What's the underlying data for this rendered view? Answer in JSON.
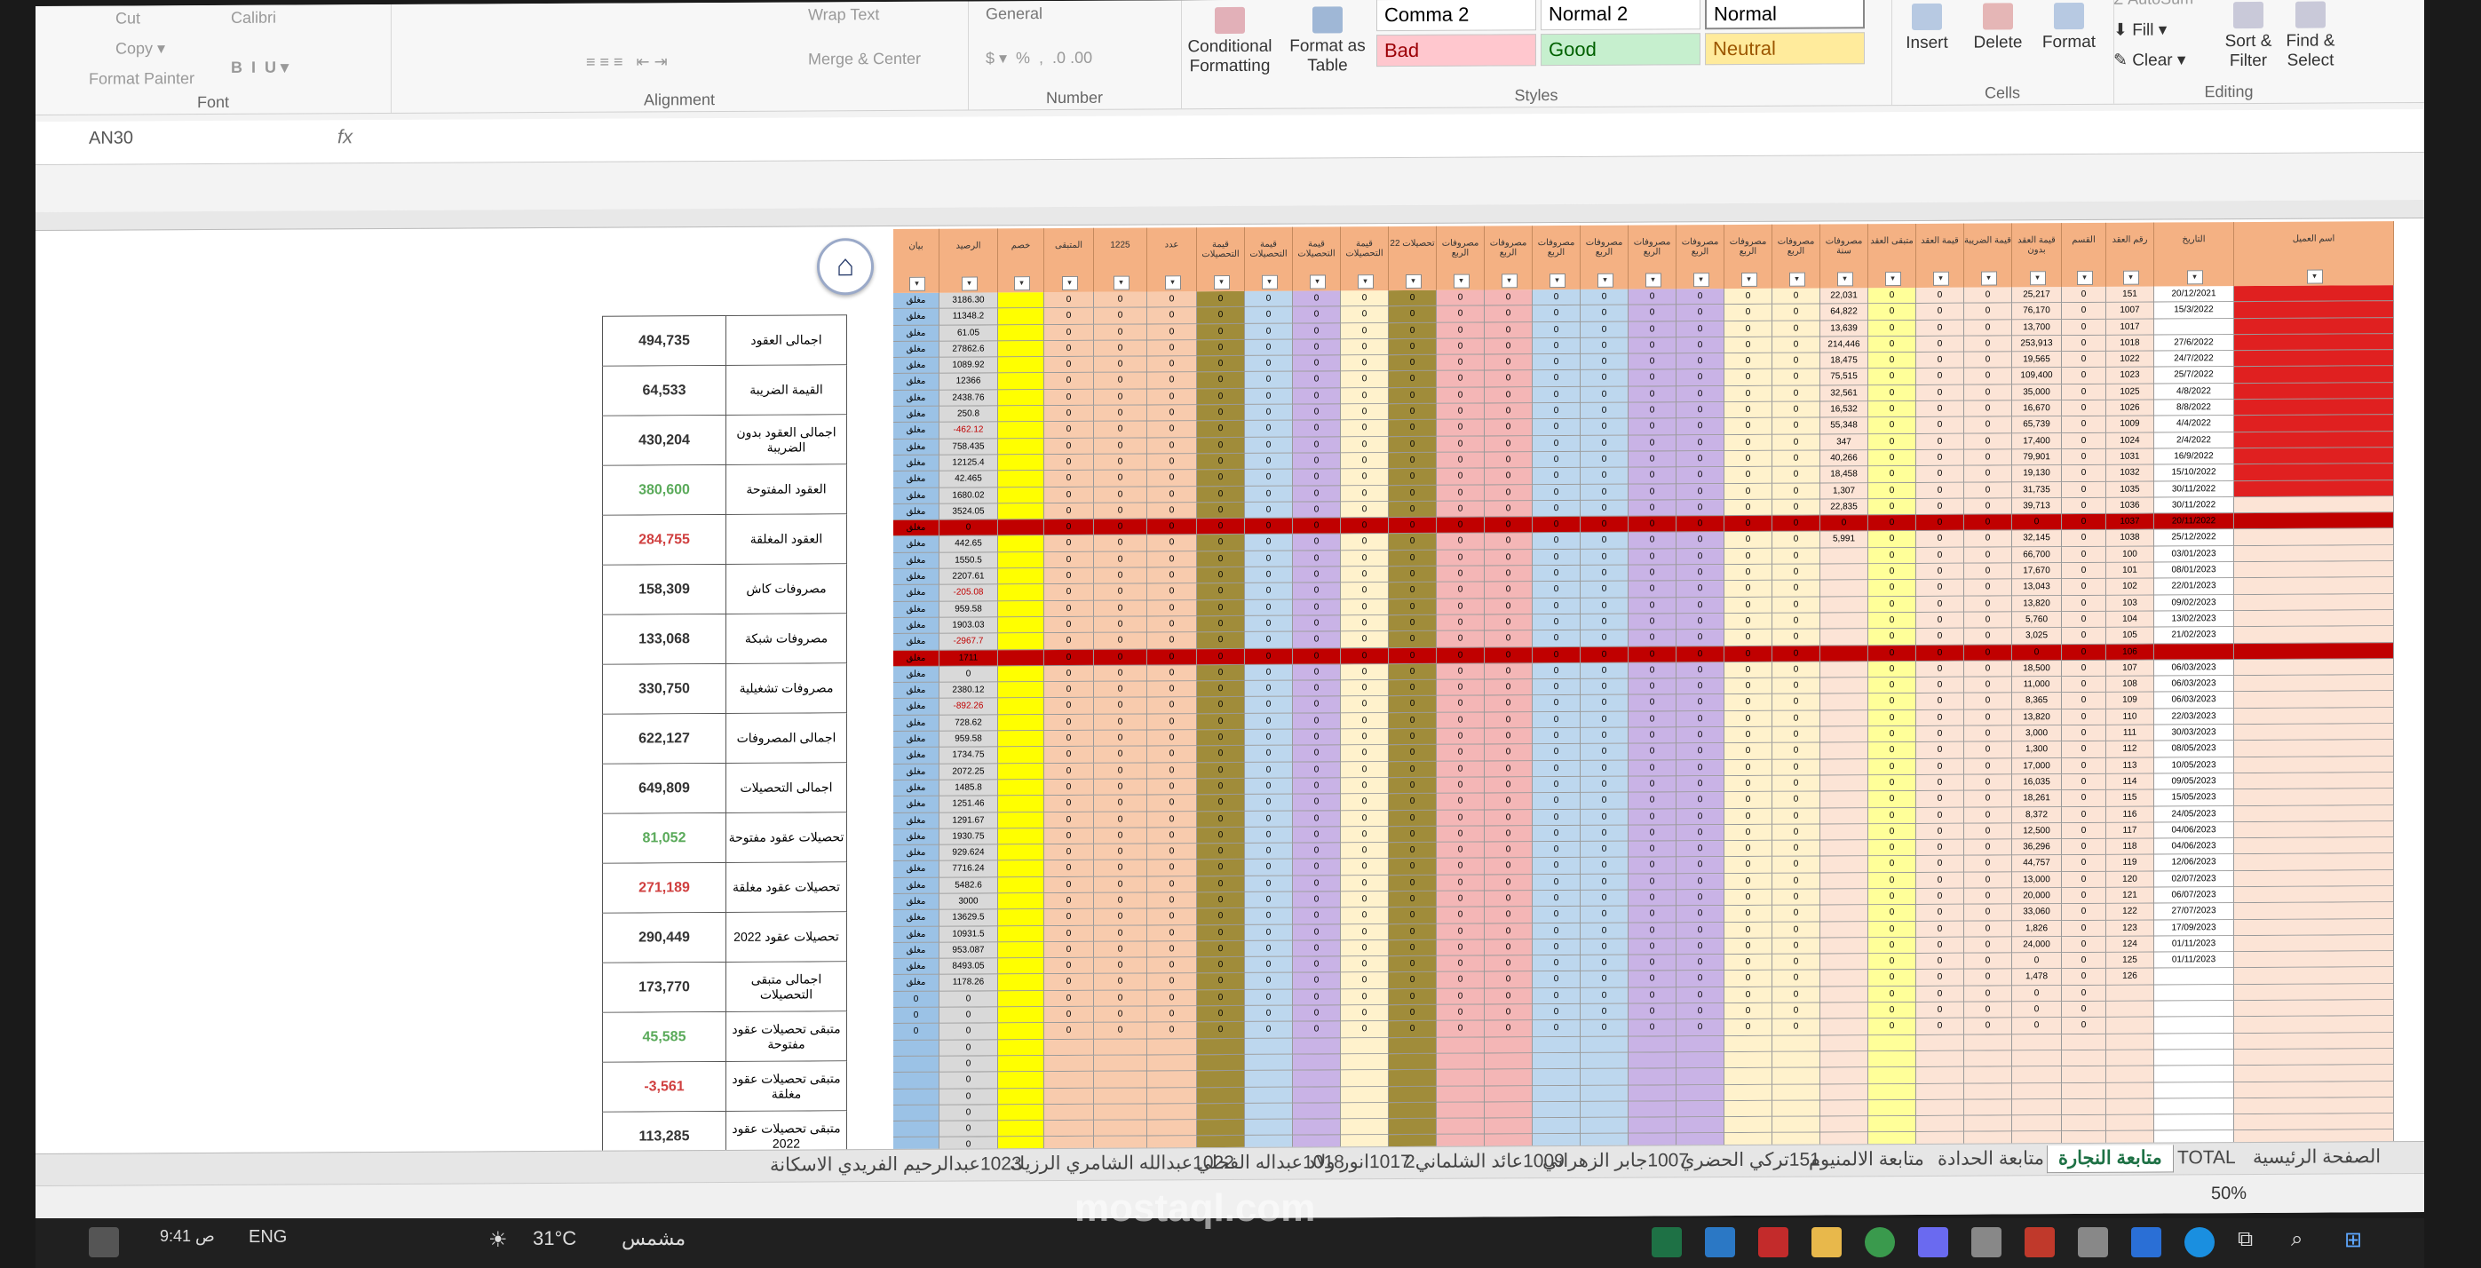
{
  "ribbon": {
    "number_format": "General",
    "wrap_text": "Wrap Text",
    "merge_center": "Merge & Center",
    "format_painter": "Format Painter",
    "conditional_formatting": "Conditional Formatting",
    "format_as_table": "Format as Table",
    "styles": {
      "comma2": "Comma 2",
      "normal2": "Normal 2",
      "normal": "Normal",
      "bad": "Bad",
      "good": "Good",
      "neutral": "Neutral"
    },
    "insert": "Insert",
    "delete": "Delete",
    "format": "Format",
    "autosum": "AutoSum",
    "fill": "Fill",
    "clear": "Clear",
    "sort_filter": "Sort & Filter",
    "find_select": "Find & Select",
    "group_labels": {
      "font": "Font",
      "alignment": "Alignment",
      "number": "Number",
      "styles": "Styles",
      "cells": "Cells",
      "editing": "Editing"
    }
  },
  "formula_bar": {
    "name_box": "AN30",
    "fx": "fx"
  },
  "summary": [
    {
      "value": "494,735",
      "label": "اجمالى العقود",
      "color": "#333"
    },
    {
      "value": "64,533",
      "label": "القيمة الضريبة",
      "color": "#333"
    },
    {
      "value": "430,204",
      "label": "اجمالى العقود بدون الضريبة",
      "color": "#333"
    },
    {
      "value": "380,600",
      "label": "العقود المفتوحة",
      "color": "#5aaa5a"
    },
    {
      "value": "284,755",
      "label": "العقود المغلقة",
      "color": "#d04040"
    },
    {
      "value": "158,309",
      "label": "مصروفات كاش",
      "color": "#333"
    },
    {
      "value": "133,068",
      "label": "مصروفات شبكة",
      "color": "#333"
    },
    {
      "value": "330,750",
      "label": "مصروفات تشغيلية",
      "color": "#333"
    },
    {
      "value": "622,127",
      "label": "اجمالى المصروفات",
      "color": "#333"
    },
    {
      "value": "649,809",
      "label": "اجمالى التحصيلات",
      "color": "#333"
    },
    {
      "value": "81,052",
      "label": "تحصيلات عقود مفتوحة",
      "color": "#5aaa5a"
    },
    {
      "value": "271,189",
      "label": "تحصيلات عقود مغلقة",
      "color": "#d04040"
    },
    {
      "value": "290,449",
      "label": "تحصيلات عقود 2022",
      "color": "#333"
    },
    {
      "value": "173,770",
      "label": "اجمالى متبقى التحصيلات",
      "color": "#333"
    },
    {
      "value": "45,585",
      "label": "متبقى تحصيلات عقود مفتوحة",
      "color": "#5aaa5a"
    },
    {
      "value": "-3,561",
      "label": "متبقى تحصيلات عقود مغلقة",
      "color": "#d04040"
    },
    {
      "value": "113,285",
      "label": "متبقى تحصيلات عقود 2022",
      "color": "#333"
    }
  ],
  "table": {
    "headers": [
      "بيان",
      "الرصيد",
      "خصم",
      "المتبقى",
      "1225",
      "عدد",
      "قيمة التحصيلات",
      "قيمة التحصيلات",
      "قيمة التحصيلات",
      "قيمة التحصيلات",
      "تحصيلات 22",
      "مصروفات الربع",
      "مصروفات الربع",
      "مصروفات الربع",
      "مصروفات الربع",
      "مصروفات الربع",
      "مصروفات الربع",
      "مصروفات الربع",
      "مصروفات الربع",
      "مصروفات سنة",
      "متبقى العقد",
      "قيمة العقد",
      "قيمة الضريبة",
      "قيمة العقد بدون",
      "القسم",
      "رقم العقد",
      "التاريخ",
      "اسم العميل"
    ],
    "date_col": [
      "20/12/2021",
      "15/3/2022",
      "",
      "27/6/2022",
      "24/7/2022",
      "25/7/2022",
      "4/8/2022",
      "8/8/2022",
      "4/4/2022",
      "2/4/2022",
      "16/9/2022",
      "15/10/2022",
      "30/11/2022",
      "30/11/2022",
      "20/11/2022",
      "25/12/2022",
      "03/01/2023",
      "08/01/2023",
      "22/01/2023",
      "09/02/2023",
      "13/02/2023",
      "21/02/2023",
      "",
      "06/03/2023",
      "06/03/2023",
      "06/03/2023",
      "22/03/2023",
      "30/03/2023",
      "08/05/2023",
      "10/05/2023",
      "09/05/2023",
      "15/05/2023",
      "24/05/2023",
      "04/06/2023",
      "04/06/2023",
      "12/06/2023",
      "02/07/2023",
      "06/07/2023",
      "27/07/2023",
      "17/09/2023",
      "01/11/2023",
      "01/11/2023"
    ],
    "contract_col": [
      "151",
      "1007",
      "1017",
      "1018",
      "1022",
      "1023",
      "1025",
      "1026",
      "1009",
      "1024",
      "1031",
      "1032",
      "1035",
      "1036",
      "1037",
      "1038",
      "100",
      "101",
      "102",
      "103",
      "104",
      "105",
      "106",
      "107",
      "108",
      "109",
      "110",
      "111",
      "112",
      "113",
      "114",
      "115",
      "116",
      "117",
      "118",
      "119",
      "120",
      "121",
      "122",
      "123",
      "124",
      "125",
      "126"
    ],
    "value_col": [
      "25,217",
      "76,170",
      "13,700",
      "253,913",
      "19,565",
      "109,400",
      "35,000",
      "16,670",
      "65,739",
      "17,400",
      "79,901",
      "19,130",
      "31,735",
      "39,713",
      "0",
      "32,145",
      "66,700",
      "17,670",
      "13,043",
      "13,820",
      "5,760",
      "3,025",
      "0",
      "18,500",
      "11,000",
      "8,365",
      "13,820",
      "3,000",
      "1,300",
      "17,000",
      "16,035",
      "18,261",
      "8,372",
      "12,500",
      "36,296",
      "44,757",
      "13,000",
      "20,000",
      "33,060",
      "1,826",
      "24,000",
      "0",
      "1,478"
    ],
    "remaining_col": [
      "22,031",
      "64,822",
      "13,639",
      "214,446",
      "18,475",
      "75,515",
      "32,561",
      "16,532",
      "55,348",
      "347",
      "40,266",
      "18,458",
      "1,307",
      "22,835",
      "0",
      "5,991",
      "",
      "",
      "",
      "",
      "",
      "",
      "",
      "",
      "",
      "",
      "",
      "",
      "",
      "",
      "",
      "",
      "",
      "",
      "",
      "",
      "",
      "",
      "",
      "",
      "",
      "",
      ""
    ],
    "balance_col": [
      "3186.30",
      "11348.2",
      "61.05",
      "27862.6",
      "1089.92",
      "12366",
      "2438.76",
      "250.8",
      "-462.12",
      "758.435",
      "12125.4",
      "42.465",
      "1680.02",
      "3524.05",
      "0",
      "442.65",
      "1550.5",
      "2207.61",
      "-205.08",
      "959.58",
      "1903.03",
      "-2967.7",
      "1711",
      "0",
      "2380.12",
      "-892.26",
      "728.62",
      "959.58",
      "1734.75",
      "2072.25",
      "1485.8",
      "1251.46",
      "1291.67",
      "1930.75",
      "929.624",
      "7716.24",
      "5482.6",
      "3000",
      "13629.5",
      "10931.5",
      "953.087",
      "8493.05",
      "1178.26"
    ]
  },
  "tabs": [
    "الصفحة الرئيسية",
    "TOTAL",
    "متابعة النجارة",
    "متابعة الحدادة",
    "متابعة الالمنيوم",
    "151تركي الحضري",
    "1007جابر الزهراني",
    "1009عائد الشلماني2",
    "1017انور ولاد",
    "1018عبداله الفحلي",
    "1022عبدالله الشامري الرزيك",
    "1023عبدالرحيم الفريدي الاسكانة"
  ],
  "status": {
    "zoom": "50%"
  },
  "taskbar": {
    "weather_temp": "31°C",
    "weather_text": "مشمس",
    "lang": "ENG",
    "time": "9:41 ص"
  },
  "watermark": "mostaql.com",
  "colors": {
    "header_orange": "#f4b183",
    "red_bar": "#c00000",
    "excel_green": "#1e7145"
  }
}
